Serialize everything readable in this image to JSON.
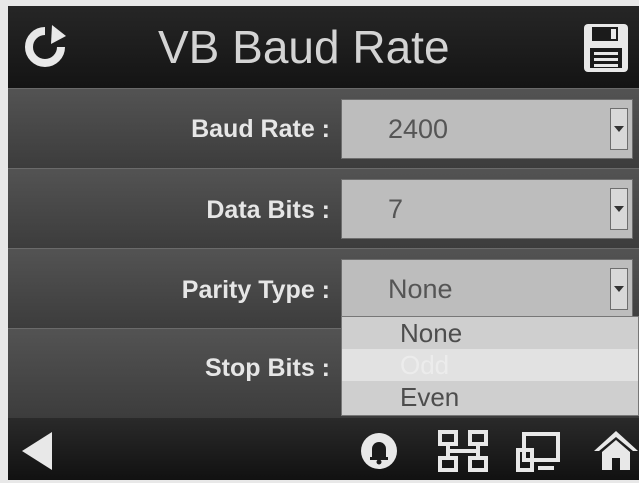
{
  "header": {
    "title": "VB Baud Rate",
    "refresh_icon": "refresh-icon",
    "save_icon": "save-icon"
  },
  "fields": [
    {
      "label": "Baud Rate :",
      "value": "2400"
    },
    {
      "label": "Data Bits :",
      "value": "7"
    },
    {
      "label": "Parity Type :",
      "value": "None"
    },
    {
      "label": "Stop Bits :",
      "value": ""
    }
  ],
  "parity_options": [
    "None",
    "Odd",
    "Even"
  ],
  "parity_highlighted": "Odd",
  "footer": {
    "icons": [
      "back-arrow-icon",
      "alarm-bell-icon",
      "network-icon",
      "display-icon",
      "home-icon"
    ]
  },
  "colors": {
    "background": "#1b1b1b",
    "row": "#4a4a4a",
    "dropdown": "#bdbdbd",
    "text": "#e6e6e6"
  }
}
